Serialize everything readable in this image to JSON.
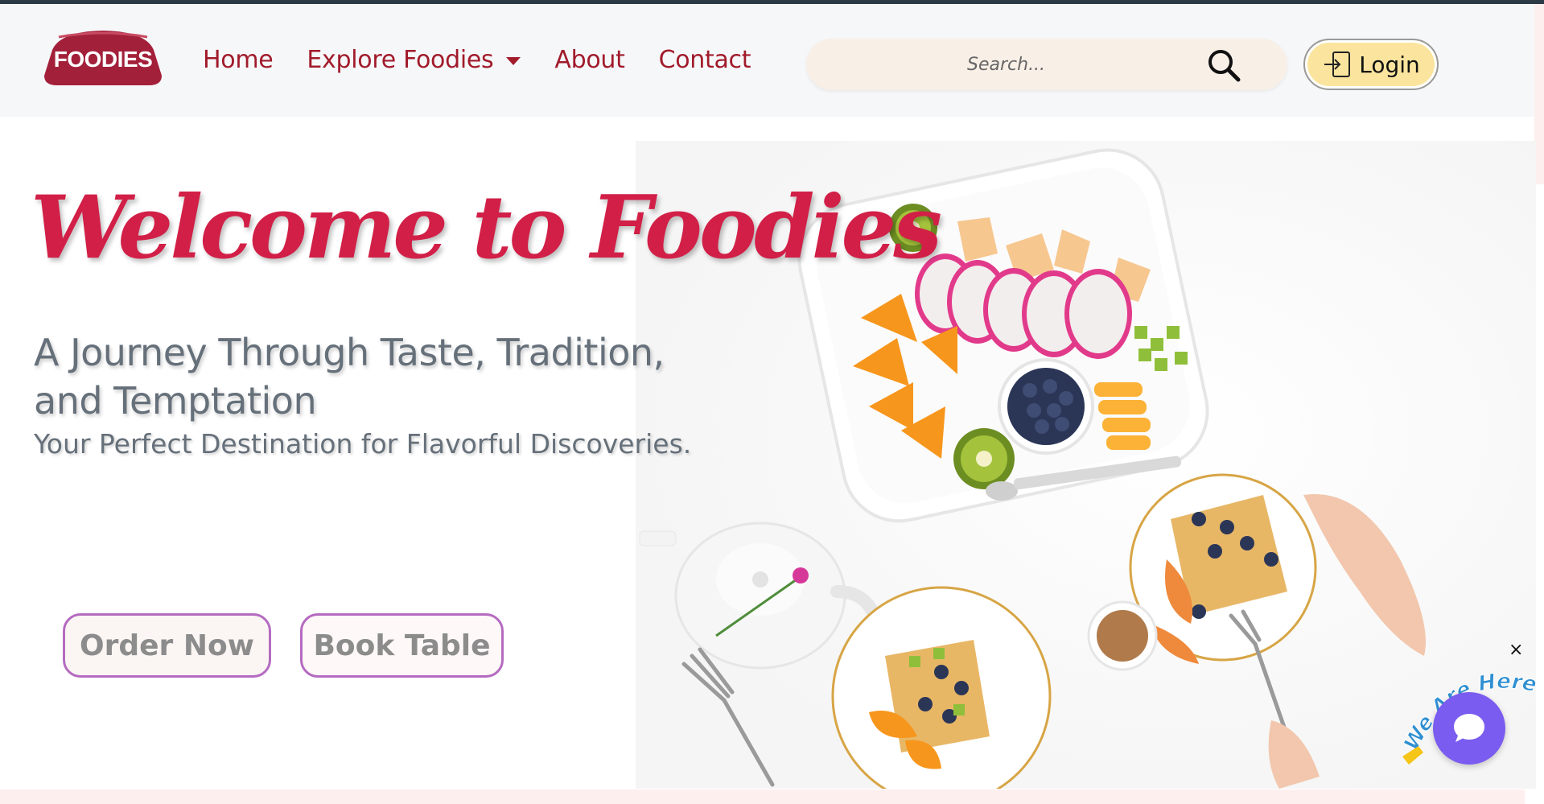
{
  "brand": {
    "logo_text": "FOODIES",
    "color": "#a3203b"
  },
  "nav": {
    "items": [
      {
        "label": "Home"
      },
      {
        "label": "Explore Foodies"
      },
      {
        "label": "About"
      },
      {
        "label": "Contact"
      }
    ]
  },
  "search": {
    "placeholder": "Search...",
    "value": ""
  },
  "login": {
    "label": "Login"
  },
  "hero": {
    "title": "Welcome to Foodies",
    "subtitle": "A Journey Through Taste, Tradition, and Temptation",
    "tagline": "Your Perfect Destination for Flavorful Discoveries.",
    "order_label": "Order Now",
    "book_label": "Book Table"
  },
  "chat_widget": {
    "badge_text": "We Are Here!",
    "close_label": "×"
  },
  "colors": {
    "accent": "#d21f47",
    "nav_text": "#a11b2b",
    "button_border": "#b46bc0",
    "chat": "#7b5cf0",
    "login_bg": "#fbe59e"
  }
}
